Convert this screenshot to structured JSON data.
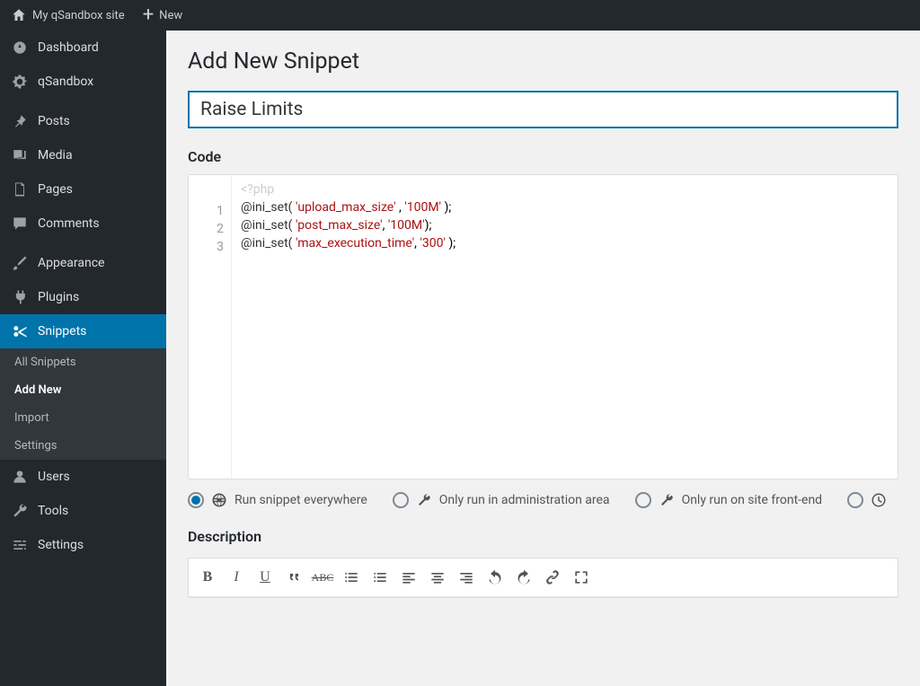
{
  "adminbar": {
    "site_name": "My qSandbox site",
    "new_label": "New"
  },
  "sidebar": {
    "items": [
      {
        "label": "Dashboard"
      },
      {
        "label": "qSandbox"
      },
      {
        "label": "Posts"
      },
      {
        "label": "Media"
      },
      {
        "label": "Pages"
      },
      {
        "label": "Comments"
      },
      {
        "label": "Appearance"
      },
      {
        "label": "Plugins"
      },
      {
        "label": "Snippets"
      },
      {
        "label": "Users"
      },
      {
        "label": "Tools"
      },
      {
        "label": "Settings"
      }
    ],
    "snippets_sub": [
      {
        "label": "All Snippets"
      },
      {
        "label": "Add New"
      },
      {
        "label": "Import"
      },
      {
        "label": "Settings"
      }
    ]
  },
  "page": {
    "heading": "Add New Snippet",
    "title_value": "Raise Limits",
    "code_label": "Code",
    "description_label": "Description"
  },
  "code": {
    "open_tag": "<?php",
    "lines": [
      {
        "n": "1",
        "fn": "@ini_set(",
        "arg1": "'upload_max_size'",
        "sep": " , ",
        "arg2": "'100M'",
        "end": " );"
      },
      {
        "n": "2",
        "fn": "@ini_set(",
        "arg1": "'post_max_size'",
        "sep": ", ",
        "arg2": "'100M'",
        "end": ");"
      },
      {
        "n": "3",
        "fn": "@ini_set(",
        "arg1": "'max_execution_time'",
        "sep": ", ",
        "arg2": "'300'",
        "end": " );"
      }
    ]
  },
  "run_options": [
    {
      "label": "Run snippet everywhere",
      "selected": true
    },
    {
      "label": "Only run in administration area",
      "selected": false
    },
    {
      "label": "Only run on site front-end",
      "selected": false
    }
  ]
}
